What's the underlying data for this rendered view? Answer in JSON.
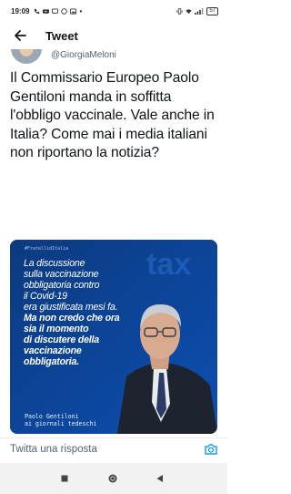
{
  "status_bar": {
    "time": "19:09",
    "battery": "57",
    "signal_text": "⁴ᴳ"
  },
  "app_bar": {
    "title": "Tweet",
    "back_icon": "arrow-left-icon"
  },
  "author": {
    "handle": "@GiorgiaMeloni"
  },
  "tweet": {
    "text": "Il Commissario Europeo Paolo Gentiloni manda in soffitta l'obbligo vaccinale. Vale anche in Italia? Come mai i media italiani non riportano la notizia?"
  },
  "media": {
    "tag": "#FratellidItalia",
    "background_word": "tax",
    "quote_normal": [
      "La discussione",
      "sulla vaccinazione",
      "obbligatoria contro",
      "il Covid-19",
      "era giustificata mesi fa."
    ],
    "quote_bold": [
      "Ma non credo che ora",
      "sia il momento",
      "di discutere della",
      "vaccinazione",
      "obbligatoria."
    ],
    "attribution_line1": "Paolo Gentiloni",
    "attribution_line2": "ai giornali tedeschi",
    "colors": {
      "background": "#0a3c86",
      "accent": "#1e66c8"
    }
  },
  "reply": {
    "placeholder": "Twitta una risposta",
    "camera_icon": "camera-icon",
    "accent_color": "#1d9bf0"
  },
  "nav_bar": {
    "recents_icon": "square-icon",
    "home_icon": "circle-icon",
    "back_icon": "triangle-back-icon"
  }
}
